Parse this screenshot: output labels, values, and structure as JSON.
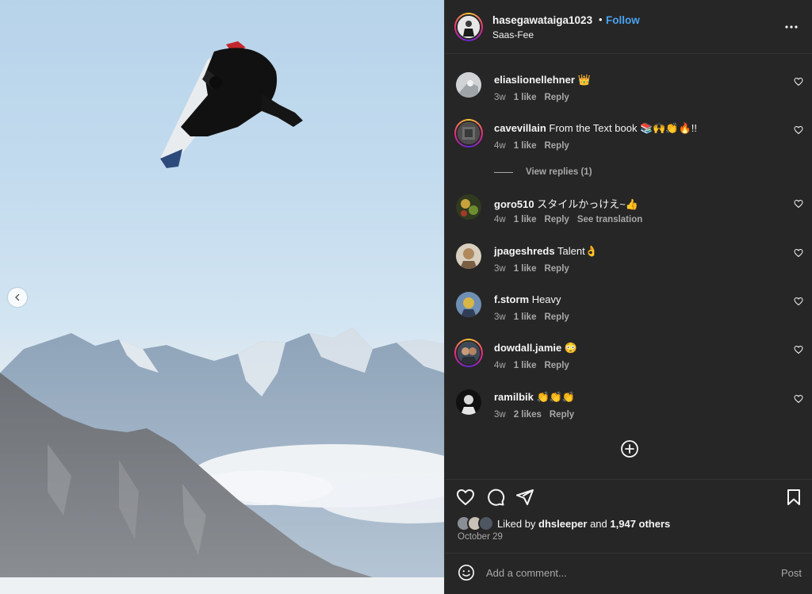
{
  "header": {
    "username": "hasegawataiga1023",
    "separator": "•",
    "follow_label": "Follow",
    "location": "Saas-Fee",
    "more_icon": "more-horizontal-icon"
  },
  "comments": [
    {
      "username": "eliaslionellehner",
      "text": "👑",
      "age": "3w",
      "likes": "1 like",
      "reply": "Reply",
      "extra": ""
    },
    {
      "username": "cavevillain",
      "text": "From the Text book 📚🙌👏🔥!!",
      "age": "4w",
      "likes": "1 like",
      "reply": "Reply",
      "extra": ""
    },
    {
      "username": "goro510",
      "text": "スタイルかっけえ~👍",
      "age": "4w",
      "likes": "1 like",
      "reply": "Reply",
      "extra": "See translation"
    },
    {
      "username": "jpageshreds",
      "text": "Talent👌",
      "age": "3w",
      "likes": "1 like",
      "reply": "Reply",
      "extra": ""
    },
    {
      "username": "f.storm",
      "text": "Heavy",
      "age": "3w",
      "likes": "1 like",
      "reply": "Reply",
      "extra": ""
    },
    {
      "username": "dowdall.jamie",
      "text": "😳",
      "age": "4w",
      "likes": "1 like",
      "reply": "Reply",
      "extra": ""
    },
    {
      "username": "ramilbik",
      "text": "👏👏👏",
      "age": "3w",
      "likes": "2 likes",
      "reply": "Reply",
      "extra": ""
    }
  ],
  "view_replies": "View replies (1)",
  "likes": {
    "prefix": "Liked by ",
    "user": "dhsleeper",
    "middle": " and ",
    "others": "1,947 others"
  },
  "date": "October 29",
  "add_comment": {
    "placeholder": "Add a comment...",
    "post_label": "Post"
  },
  "colors": {
    "panel_bg": "#262626",
    "follow_blue": "#4aa3f0",
    "secondary_text": "#a8a8a8"
  }
}
